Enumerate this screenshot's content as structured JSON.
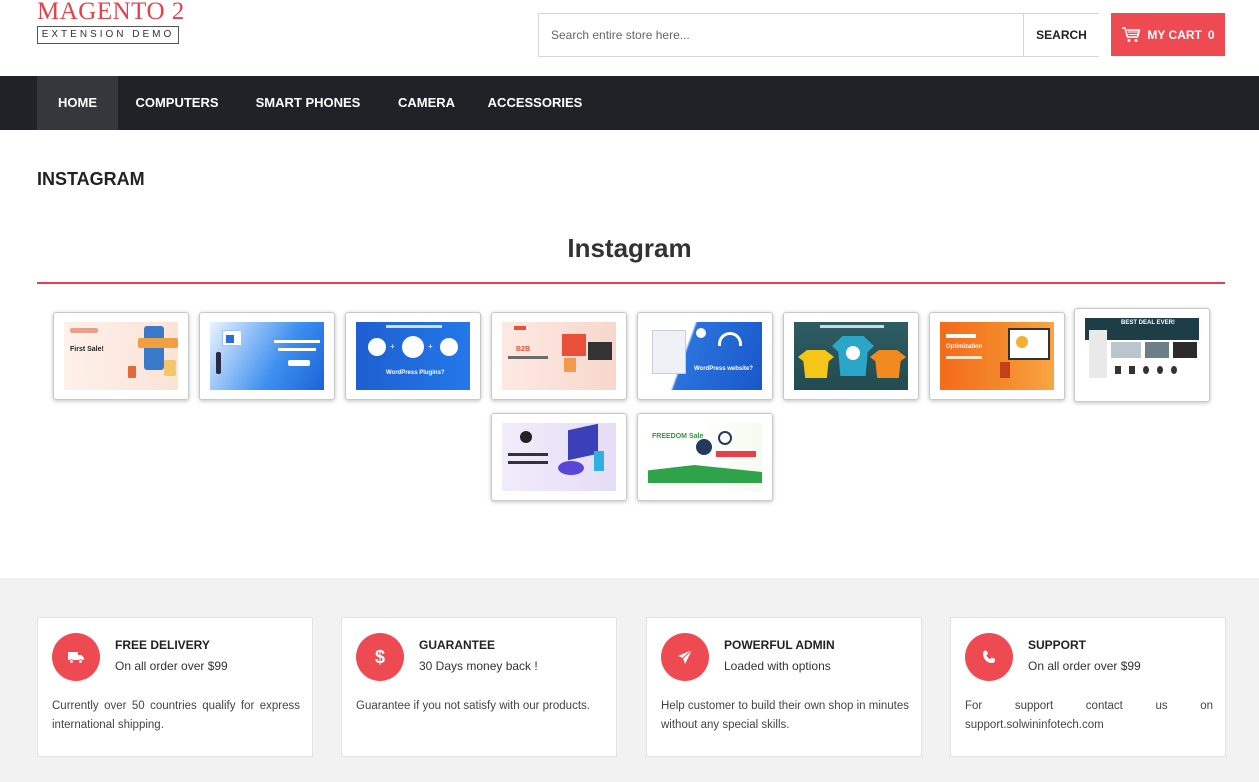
{
  "header": {
    "logo_main": "MAGENTO 2",
    "logo_sub": "EXTENSION DEMO",
    "search_placeholder": "Search entire store here...",
    "search_button": "SEARCH",
    "cart_label": "MY CART",
    "cart_count": "0"
  },
  "nav": {
    "items": [
      {
        "label": "HOME"
      },
      {
        "label": "COMPUTERS"
      },
      {
        "label": "SMART PHONES"
      },
      {
        "label": "CAMERA"
      },
      {
        "label": "ACCESSORIES"
      }
    ]
  },
  "page": {
    "title": "INSTAGRAM"
  },
  "instagram": {
    "heading": "Instagram",
    "posts": [
      {
        "caption": "First Sale!"
      },
      {
        "caption": ""
      },
      {
        "caption": "WordPress Plugins?"
      },
      {
        "caption": "B2B"
      },
      {
        "caption": "WordPress website?"
      },
      {
        "caption": ""
      },
      {
        "caption": "Optimization"
      },
      {
        "caption": "BEST DEAL EVER!"
      },
      {
        "caption": ""
      },
      {
        "caption": "FREEDOM Sale"
      }
    ]
  },
  "features": [
    {
      "icon": "truck-icon",
      "title": "FREE DELIVERY",
      "subtitle": "On all order over $99",
      "description": "Currently over 50 countries qualify for express international shipping."
    },
    {
      "icon": "dollar-icon",
      "title": "GUARANTEE",
      "subtitle": "30 Days money back !",
      "description": "Guarantee if you not satisfy with our products."
    },
    {
      "icon": "paper-plane-icon",
      "title": "POWERFUL ADMIN",
      "subtitle": "Loaded with options",
      "description": "Help customer to build their own shop in minutes without any special skills."
    },
    {
      "icon": "phone-icon",
      "title": "SUPPORT",
      "subtitle": "On all order over $99",
      "description": "For support contact us on support.solwininfotech.com"
    }
  ],
  "colors": {
    "accent": "#ed4a52",
    "nav_bg": "#1f2328",
    "nav_active": "#34383d",
    "features_bg": "#f2f2f2"
  }
}
